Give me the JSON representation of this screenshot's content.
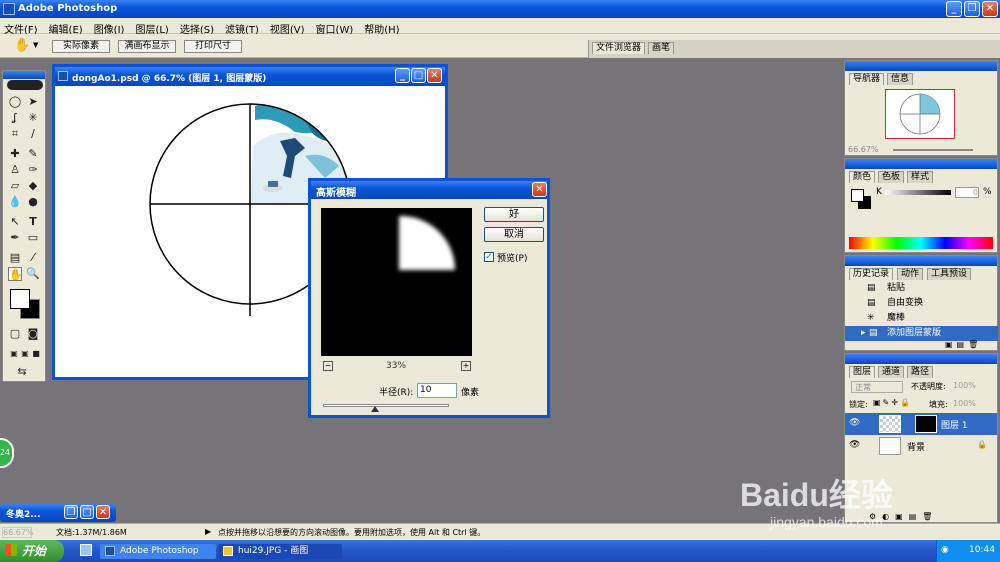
{
  "app": {
    "title": "Adobe Photoshop"
  },
  "menu": [
    "文件(F)",
    "编辑(E)",
    "图像(I)",
    "图层(L)",
    "选择(S)",
    "滤镜(T)",
    "视图(V)",
    "窗口(W)",
    "帮助(H)"
  ],
  "options": {
    "actual_pixels": "实际像素",
    "fit_screen": "满画布显示",
    "print_size": "打印尺寸"
  },
  "palette_well": {
    "file_browser": "文件浏览器",
    "brushes": "画笔"
  },
  "document": {
    "title": "dongAo1.psd @ 66.7% (图层 1, 图层蒙版)"
  },
  "dialog": {
    "title": "高斯模糊",
    "ok": "好",
    "cancel": "取消",
    "preview_label": "预览(P)",
    "preview_checked": true,
    "zoom": "33%",
    "radius_label": "半径(R):",
    "radius_value": "10",
    "radius_unit": "像素",
    "zoom_minus": "−",
    "zoom_plus": "+"
  },
  "navigator": {
    "tab1": "导航器",
    "tab2": "信息",
    "zoom": "66.67%"
  },
  "color_panel": {
    "tab1": "颜色",
    "tab2": "色板",
    "tab3": "样式",
    "channel": "K",
    "value": "0",
    "unit": "%"
  },
  "history": {
    "tab1": "历史记录",
    "tab2": "动作",
    "tab3": "工具预设",
    "items": [
      "粘贴",
      "自由变换",
      "魔棒",
      "添加图层蒙版"
    ]
  },
  "layers": {
    "tab1": "图层",
    "tab2": "通道",
    "tab3": "路径",
    "blend_mode": "正常",
    "opacity_label": "不透明度:",
    "opacity_value": "100%",
    "lock_label": "锁定:",
    "fill_label": "填充:",
    "fill_value": "100%",
    "items": [
      {
        "name": "图层 1"
      },
      {
        "name": "背景"
      }
    ]
  },
  "status": {
    "zoom": "66.67%",
    "doc": "文档:1.37M/1.86M",
    "hint": "点按并拖移以沿想要的方向滚动图像。要用附加选项，使用 Alt 和 Ctrl 键。"
  },
  "minimized_doc": {
    "title": "冬奥2..."
  },
  "left_badge": "24",
  "taskbar": {
    "start": "开始",
    "tasks": [
      "Adobe Photoshop",
      "hui29.JPG - 画图"
    ],
    "time": "10:44"
  },
  "watermark": {
    "text": "Baidu经验",
    "url": "jingyan.baidu.com"
  }
}
